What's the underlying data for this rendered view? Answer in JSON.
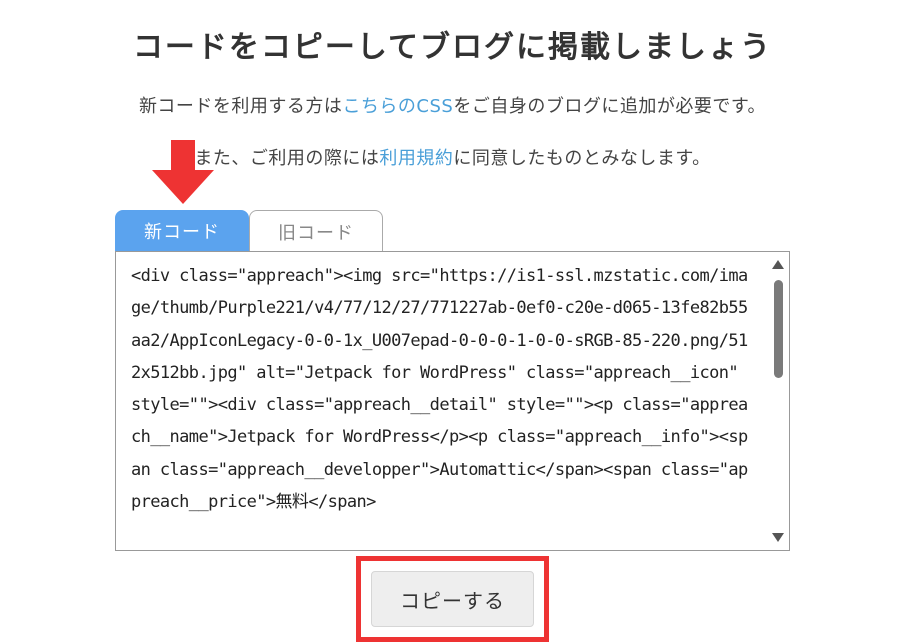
{
  "title": "コードをコピーしてブログに掲載しましょう",
  "description": {
    "line1_before": "新コードを利用する方は",
    "line1_link": "こちらのCSS",
    "line1_after": "をご自身のブログに追加が必要です。",
    "line2_before": "また、ご利用の際には",
    "line2_link": "利用規約",
    "line2_after": "に同意したものとみなします。"
  },
  "tabs": {
    "new_label": "新コード",
    "old_label": "旧コード",
    "active": "new"
  },
  "code": {
    "value": "<div class=\"appreach\"><img src=\"https://is1-ssl.mzstatic.com/image/thumb/Purple221/v4/77/12/27/771227ab-0ef0-c20e-d065-13fe82b55aa2/AppIconLegacy-0-0-1x_U007epad-0-0-0-1-0-0-sRGB-85-220.png/512x512bb.jpg\" alt=\"Jetpack for WordPress\" class=\"appreach__icon\" style=\"\"><div class=\"appreach__detail\" style=\"\"><p class=\"appreach__name\">Jetpack for WordPress</p><p class=\"appreach__info\"><span class=\"appreach__developper\">Automattic</span><span class=\"appreach__price\">無料</span>"
  },
  "copy_button": {
    "label": "コピーする"
  },
  "colors": {
    "accent": "#5ba3ee",
    "link": "#4a9fd8",
    "highlight": "#ee3333"
  },
  "icons": {
    "arrow": "red-down-arrow-icon",
    "scroll_up": "triangle-up-icon",
    "scroll_down": "triangle-down-icon"
  }
}
